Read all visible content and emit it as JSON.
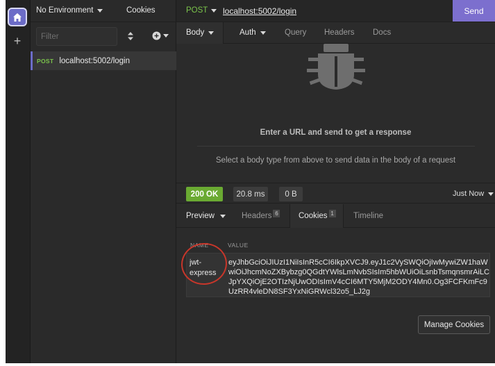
{
  "sidebar": {
    "environment": "No Environment",
    "cookies_label": "Cookies",
    "filter_placeholder": "Filter",
    "request": {
      "method": "POST",
      "name": "localhost:5002/login"
    }
  },
  "url_bar": {
    "method": "POST",
    "url": "localhost:5002/login",
    "send_label": "Send"
  },
  "request_tabs": [
    "Body",
    "Auth",
    "Query",
    "Headers",
    "Docs"
  ],
  "empty_state": {
    "title": "Enter a URL and send to get a response",
    "subtitle": "Select a body type from above to send data in the body of a request"
  },
  "status": {
    "code": "200 OK",
    "time": "20.8 ms",
    "size": "0 B",
    "when": "Just Now"
  },
  "response_tabs": {
    "preview": "Preview",
    "headers": "Headers",
    "headers_count": "6",
    "cookies": "Cookies",
    "cookies_count": "1",
    "timeline": "Timeline"
  },
  "cookies_table": {
    "name_header": "NAME",
    "value_header": "VALUE",
    "rows": [
      {
        "name": "jwt-express",
        "value": "eyJhbGciOiJIUzI1NiIsInR5cCI6IkpXVCJ9.eyJ1c2VySWQiOjIwMywiZW1haWwiOiJhcmNoZXBybzg0QGdtYWlsLmNvbSIsIm5hbWUiOiLsnbTsmqnsmrAiLCJpYXQiOjE2OTIzNjUwODIsImV4cCI6MTY5MjM2ODY4Mn0.Og3FCFKmFc9UzRR4vleDN8SF3YxNiGRWcl32o5_LJ2g"
      }
    ]
  },
  "manage_cookies_label": "Manage Cookies",
  "colors": {
    "accent": "#7c6fce",
    "success": "#6aaa32",
    "method_post": "#7bc44b",
    "annotation": "#c8362a"
  }
}
